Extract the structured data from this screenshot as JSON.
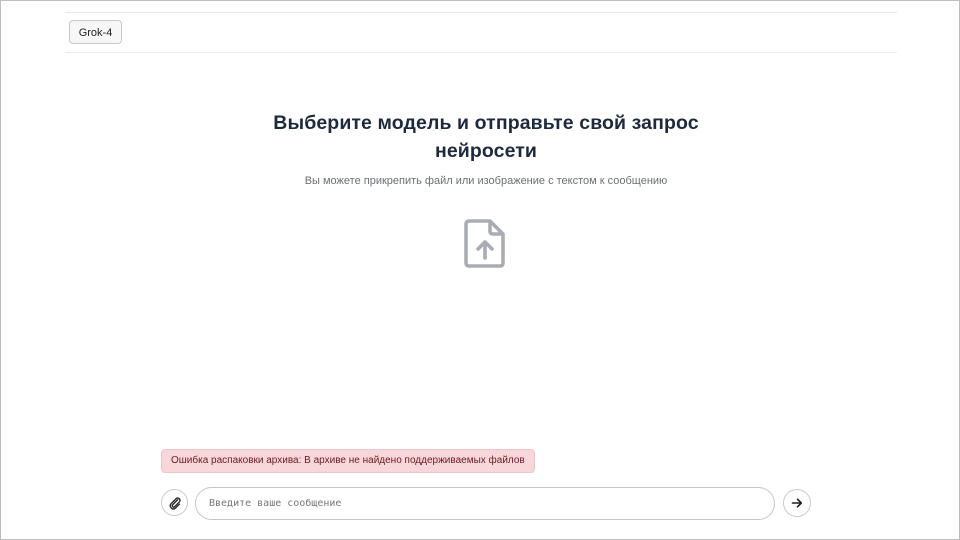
{
  "header": {
    "model_button_label": "Grok-4"
  },
  "main": {
    "title": "Выберите модель и отправьте свой запрос нейросети",
    "subtitle": "Вы можете прикрепить файл или изображение с текстом к сообщению",
    "upload_icon": "file-upload-icon"
  },
  "alert": {
    "text": "Ошибка распаковки архива: В архиве не найдено поддерживаемых файлов",
    "color_bg": "#f8d7da",
    "color_text": "#6a1a24"
  },
  "composer": {
    "attach_icon": "paperclip-icon",
    "placeholder": "Введите ваше сообщение",
    "value": "",
    "send_icon": "arrow-right-icon"
  },
  "colors": {
    "title": "#1e2a3b",
    "subtitle": "#6b6f76",
    "icon_gray": "#a9adb3"
  }
}
